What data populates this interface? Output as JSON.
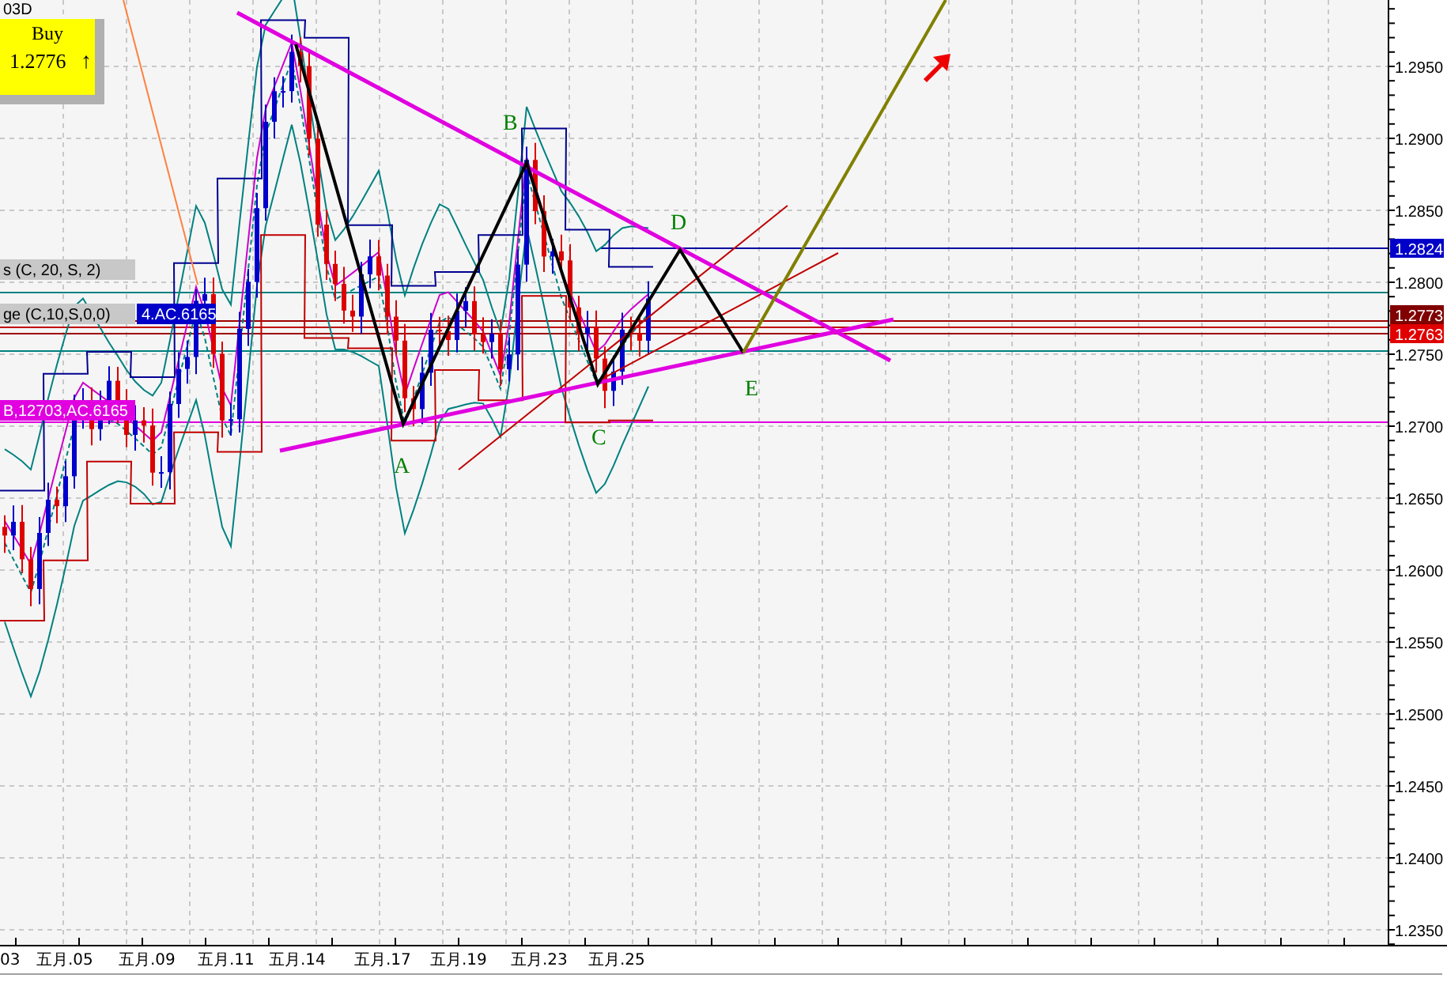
{
  "header": {
    "symbol": "03D"
  },
  "order_box": {
    "action": "Buy",
    "price": "1.2776",
    "arrow": "↑"
  },
  "indicator_tags": [
    {
      "label": "s (C, 20, S, 2)",
      "color": "#c8c8c8"
    },
    {
      "label": "ge (C,10,S,0,0)",
      "color": "#c8c8c8",
      "value": {
        "text": "4.AC.6165",
        "color": "#0000c8"
      }
    },
    {
      "label": "B,12703,AC.6165",
      "color": "#e000e0"
    }
  ],
  "pattern_points": [
    {
      "label": "B"
    },
    {
      "label": "D"
    },
    {
      "label": "A"
    },
    {
      "label": "C"
    },
    {
      "label": "E"
    }
  ],
  "price_tags": [
    {
      "text": "1.2824",
      "color": "#0000c8"
    },
    {
      "text": "1.2773",
      "color": "#800000"
    },
    {
      "text": "1.2763",
      "color": "#e00000"
    }
  ],
  "y_axis": {
    "labels": [
      "1.2950",
      "1.2900",
      "1.2850",
      "1.2800",
      "1.2750",
      "1.2700",
      "1.2650",
      "1.2600",
      "1.2550",
      "1.2500",
      "1.2450",
      "1.2400",
      "1.2350"
    ]
  },
  "x_axis": {
    "labels": [
      "03",
      "五月.05",
      "五月.09",
      "五月.11",
      "五月.14",
      "五月.17",
      "五月.19",
      "五月.23",
      "五月.25"
    ]
  }
}
